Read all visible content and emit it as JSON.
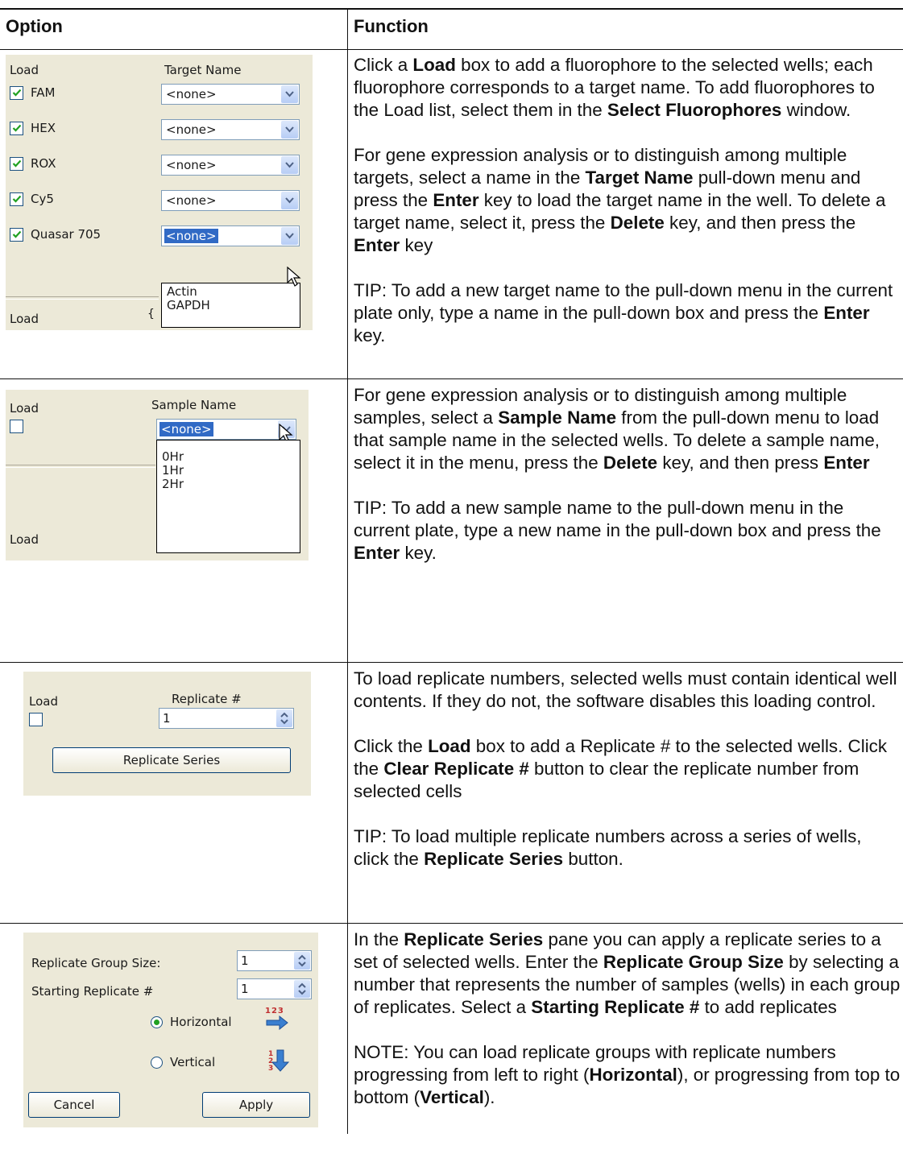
{
  "table": {
    "header": {
      "option": "Option",
      "function": "Function"
    }
  },
  "rows": [
    {
      "screenshot": {
        "load_label": "Load",
        "target_label": "Target Name",
        "fluorophores": [
          {
            "name": "FAM",
            "checked": true,
            "value": "<none>"
          },
          {
            "name": "HEX",
            "checked": true,
            "value": "<none>"
          },
          {
            "name": "ROX",
            "checked": true,
            "value": "<none>"
          },
          {
            "name": "Cy5",
            "checked": true,
            "value": "<none>"
          },
          {
            "name": "Quasar 705",
            "checked": true,
            "value": "<none>"
          }
        ],
        "dropdown_options": [
          "Actin",
          "GAPDH"
        ],
        "bottom_load_label": "Load"
      },
      "paragraphs": [
        "Click a <b>Load</b> box to add a fluorophore to the selected wells; each fluorophore corresponds to a target name. To add fluorophores to the Load list, select them in the <b>Select Fluorophores</b> window.",
        "For gene expression analysis or to distinguish among multiple targets, select a name in the <b>Target Name</b> pull-down menu and press the <b>Enter</b> key to load the target name in the well. To delete a target name, select it, press the <b>Delete</b> key, and then press the <b>Enter</b> key",
        "TIP: To add a new target name to the pull-down menu in the current plate only, type a name in the pull-down box and press the <b>Enter</b> key."
      ]
    },
    {
      "screenshot": {
        "load_label": "Load",
        "sample_label": "Sample Name",
        "value": "<none>",
        "dropdown_options": [
          "0Hr",
          "1Hr",
          "2Hr"
        ],
        "bottom_load_label": "Load"
      },
      "paragraphs": [
        "For gene expression analysis or to distinguish among multiple samples, select a <b>Sample Name</b> from the pull-down menu to load that sample name in the selected wells. To delete a sample name, select it in the menu, press the <b>Delete</b> key, and then press <b>Enter</b>",
        "TIP: To add a new sample name to the pull-down menu in the current plate, type a new name in the pull-down box and press the <b>Enter</b> key."
      ]
    },
    {
      "screenshot": {
        "load_label": "Load",
        "replicate_label": "Replicate #",
        "replicate_value": "1",
        "series_button": "Replicate Series"
      },
      "paragraphs": [
        "To load replicate numbers, selected wells must contain identical well contents. If they do not, the software disables this loading control.",
        "Click the <b>Load</b> box to add a Replicate # to the selected wells. Click the <b>Clear Replicate #</b> button to clear the replicate number from selected cells",
        "TIP: To load multiple replicate numbers across a series of wells, click the <b>Replicate Series</b> button."
      ]
    },
    {
      "screenshot": {
        "group_size_label": "Replicate Group Size:",
        "group_size_value": "1",
        "starting_label": "Starting Replicate #",
        "starting_value": "1",
        "horizontal_label": "Horizontal",
        "vertical_label": "Vertical",
        "selected_direction": "Horizontal",
        "horizontal_icon_text": "123",
        "cancel_button": "Cancel",
        "apply_button": "Apply"
      },
      "paragraphs": [
        "In the <b>Replicate Series</b> pane you can apply a replicate series to a set of selected wells. Enter the <b>Replicate Group Size</b> by selecting a number that represents the number of samples (wells) in each group of replicates. Select a <b>Starting Replicate #</b> to add replicates",
        "NOTE: You can load replicate groups with replicate numbers progressing from left to right (<b>Horizontal</b>), or progressing from top to bottom (<b>Vertical</b>)."
      ]
    }
  ],
  "colors": {
    "panel_bg": "#ece9d8",
    "checkbox_border": "#1c5180",
    "check_green": "#21a121",
    "selection_blue": "#316ac5"
  }
}
